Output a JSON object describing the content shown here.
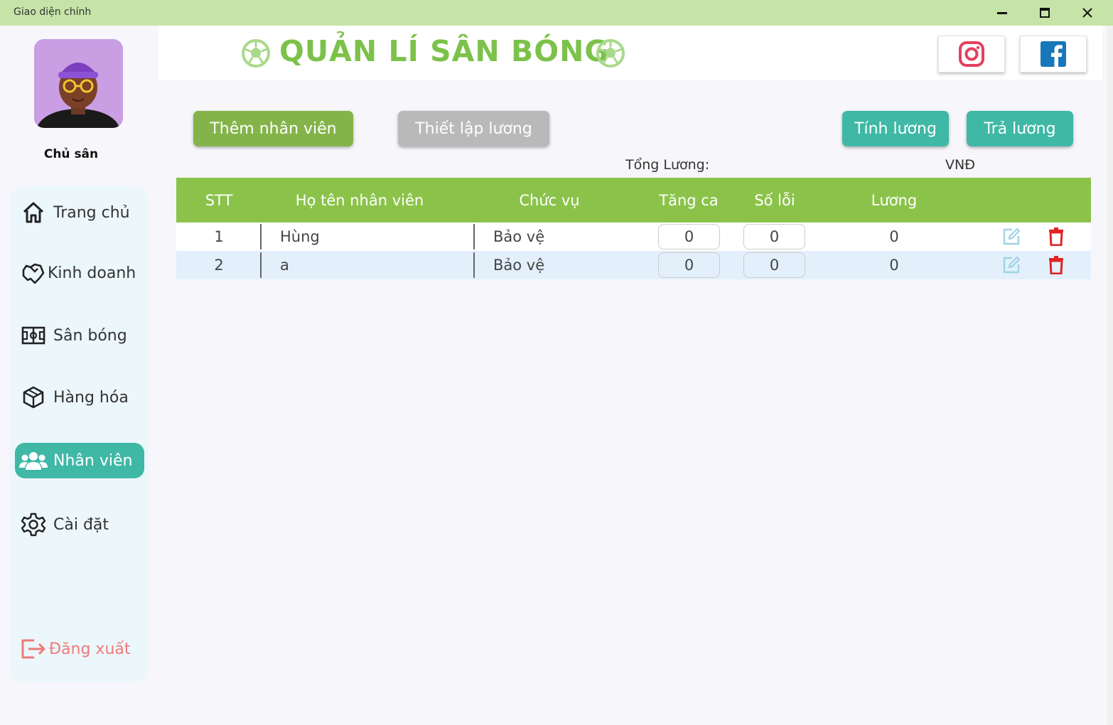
{
  "window": {
    "title": "Giao diện chính"
  },
  "header": {
    "title": "QUẢN LÍ SÂN BÓNG"
  },
  "user": {
    "role": "Chủ sân"
  },
  "nav": {
    "home": "Trang chủ",
    "business": "Kinh doanh",
    "fields": "Sân bóng",
    "goods": "Hàng hóa",
    "staff": "Nhân viên",
    "settings": "Cài đặt",
    "logout": "Đăng xuất"
  },
  "actions": {
    "add_staff": "Thêm nhân viên",
    "salary_setup": "Thiết lập lương",
    "calc_salary": "Tính lương",
    "pay_salary": "Trả lương"
  },
  "summary": {
    "total_label": "Tổng Lương:",
    "currency": "VNĐ"
  },
  "table": {
    "headers": {
      "stt": "STT",
      "name": "Họ tên nhân viên",
      "position": "Chức vụ",
      "overtime": "Tăng ca",
      "errors": "Số lỗi",
      "salary": "Lương"
    },
    "rows": [
      {
        "stt": "1",
        "name": "Hùng",
        "position": "Bảo vệ",
        "overtime": "0",
        "errors": "0",
        "salary": "0"
      },
      {
        "stt": "2",
        "name": "a",
        "position": "Bảo vệ",
        "overtime": "0",
        "errors": "0",
        "salary": "0"
      }
    ]
  },
  "colors": {
    "accent_green": "#7cc24a",
    "table_header": "#8bc34a",
    "teal": "#3fb8a6",
    "delete_red": "#e02424",
    "logout_red": "#f07a7a"
  },
  "icons": [
    "minimize-icon",
    "maximize-icon",
    "close-icon",
    "soccer-ball-icon",
    "instagram-icon",
    "facebook-icon",
    "home-icon",
    "handshake-icon",
    "field-icon",
    "box-icon",
    "users-icon",
    "gear-icon",
    "logout-icon",
    "edit-icon",
    "trash-icon"
  ]
}
